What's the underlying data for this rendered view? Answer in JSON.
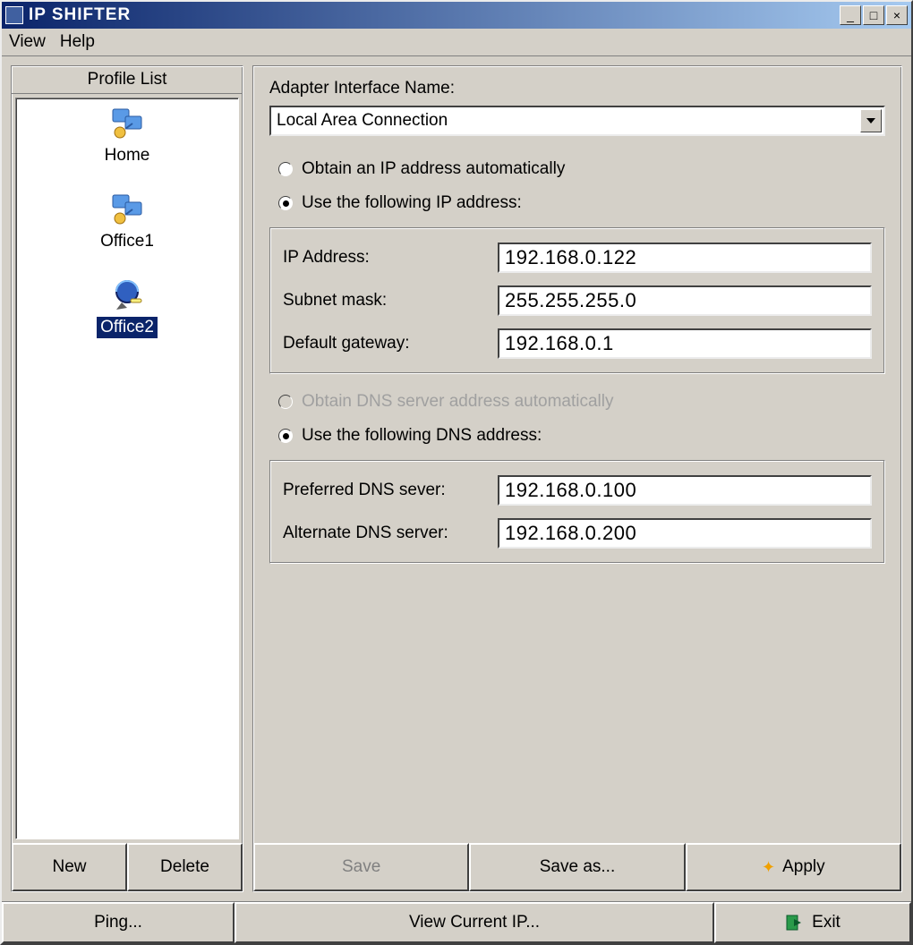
{
  "window": {
    "title": "IP SHIFTER"
  },
  "menu": {
    "view": "View",
    "help": "Help"
  },
  "sidebar": {
    "header": "Profile List",
    "items": [
      {
        "label": "Home",
        "selected": false
      },
      {
        "label": "Office1",
        "selected": false
      },
      {
        "label": "Office2",
        "selected": true
      }
    ],
    "new_btn": "New",
    "delete_btn": "Delete"
  },
  "main": {
    "adapter_label": "Adapter Interface Name:",
    "adapter_value": "Local Area Connection",
    "ip_auto_label": "Obtain an IP address  automatically",
    "ip_manual_label": "Use the following IP address:",
    "ip_mode": "manual",
    "ip": {
      "ip_label": "IP  Address:",
      "ip_value": "192.168.0.122",
      "subnet_label": "Subnet mask:",
      "subnet_value": "255.255.255.0",
      "gateway_label": "Default gateway:",
      "gateway_value": "192.168.0.1"
    },
    "dns_auto_label": "Obtain DNS server  address automatically",
    "dns_manual_label": "Use the following DNS address:",
    "dns_mode": "manual",
    "dns": {
      "preferred_label": "Preferred DNS sever:",
      "preferred_value": "192.168.0.100",
      "alternate_label": "Alternate DNS server:",
      "alternate_value": "192.168.0.200"
    },
    "save_btn": "Save",
    "save_as_btn": "Save as...",
    "apply_btn": "Apply"
  },
  "bottom": {
    "ping_btn": "Ping...",
    "view_ip_btn": "View Current IP...",
    "exit_btn": "Exit"
  }
}
